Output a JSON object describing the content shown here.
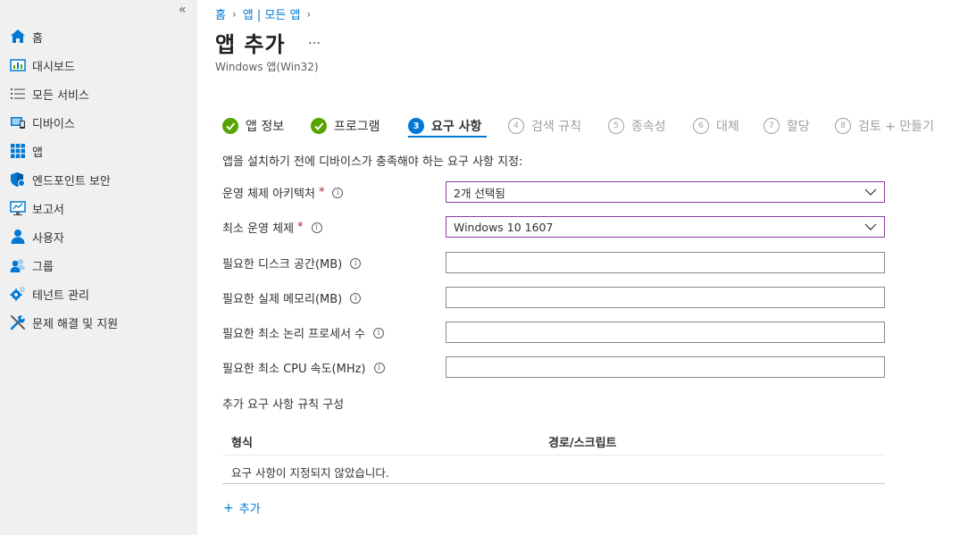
{
  "sidebar": {
    "collapse_glyph": "«",
    "items": [
      {
        "label": "홈",
        "icon": "home-icon"
      },
      {
        "label": "대시보드",
        "icon": "dashboard-icon"
      },
      {
        "label": "모든 서비스",
        "icon": "list-icon"
      },
      {
        "label": "디바이스",
        "icon": "devices-icon"
      },
      {
        "label": "앱",
        "icon": "apps-icon"
      },
      {
        "label": "엔드포인트 보안",
        "icon": "shield-icon"
      },
      {
        "label": "보고서",
        "icon": "reports-icon"
      },
      {
        "label": "사용자",
        "icon": "user-icon"
      },
      {
        "label": "그룹",
        "icon": "group-icon"
      },
      {
        "label": "테넌트 관리",
        "icon": "tenant-gear-icon"
      },
      {
        "label": "문제 해결 및 지원",
        "icon": "tools-icon"
      }
    ]
  },
  "breadcrumb": {
    "items": [
      "홈",
      "앱 | 모든 앱"
    ],
    "separator": "›"
  },
  "header": {
    "title": "앱 추가",
    "more": "…",
    "subtitle": "Windows 앱(Win32)"
  },
  "wizard": {
    "steps": [
      {
        "number": "",
        "label": "앱 정보",
        "state": "done"
      },
      {
        "number": "",
        "label": "프로그램",
        "state": "done"
      },
      {
        "number": "3",
        "label": "요구 사항",
        "state": "current"
      },
      {
        "number": "4",
        "label": "검색 규칙",
        "state": "future"
      },
      {
        "number": "5",
        "label": "종속성",
        "state": "future"
      },
      {
        "number": "6",
        "label": "대체",
        "state": "future"
      },
      {
        "number": "7",
        "label": "할당",
        "state": "future"
      },
      {
        "number": "8",
        "label": "검토 + 만들기",
        "state": "future"
      }
    ]
  },
  "form": {
    "instruction": "앱을 설치하기 전에 디바이스가 충족해야 하는 요구 사항 지정:",
    "required_mark": "*",
    "info_glyph": "i",
    "os_architecture": {
      "label": "운영 체제 아키텍처",
      "value": "2개 선택됨"
    },
    "min_os": {
      "label": "최소 운영 체제",
      "value": "Windows 10 1607"
    },
    "disk_space": {
      "label": "필요한 디스크 공간(MB)",
      "value": ""
    },
    "physical_memory": {
      "label": "필요한 실제 메모리(MB)",
      "value": ""
    },
    "logical_processors": {
      "label": "필요한 최소 논리 프로세서 수",
      "value": ""
    },
    "cpu_speed": {
      "label": "필요한 최소 CPU 속도(MHz)",
      "value": ""
    },
    "additional_rules_title": "추가 요구 사항 규칙 구성"
  },
  "rules_table": {
    "columns": [
      "형식",
      "경로/스크립트"
    ],
    "empty_message": "요구 사항이 지정되지 않았습니다."
  },
  "add_link": {
    "plus": "+",
    "label": "추가"
  },
  "colors": {
    "accent": "#0078d4",
    "done_green": "#57a300",
    "required_red": "#a4262c",
    "focus_border": "#8a3f9e",
    "sidebar_bg": "#f0f0f0"
  }
}
